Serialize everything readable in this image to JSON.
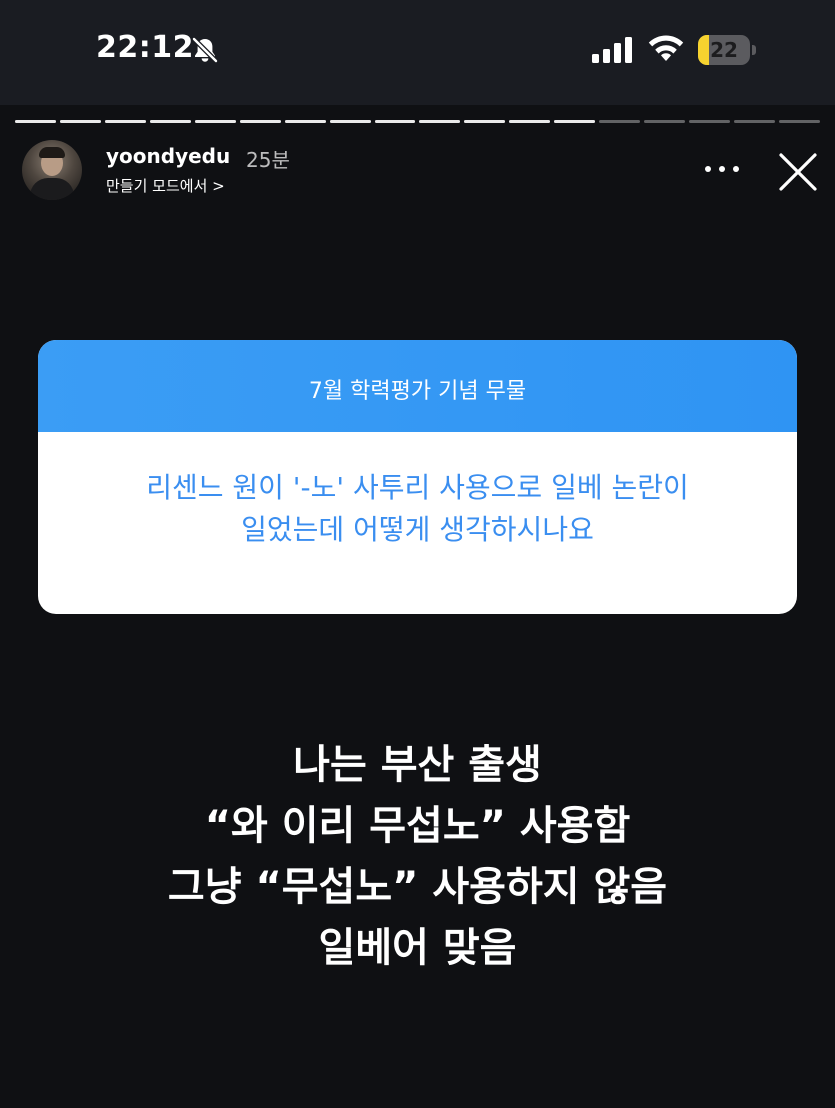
{
  "status_bar": {
    "time": "22:12",
    "battery_level": "22",
    "battery_fraction": 0.22,
    "icons": [
      "bell-slash-icon",
      "cellular-signal-icon",
      "wifi-icon",
      "battery-icon"
    ]
  },
  "story_progress": {
    "segment_count": 18,
    "viewed_count": 13
  },
  "story_header": {
    "username": "yoondyedu",
    "time_ago": "25분",
    "sub_label": "만들기 모드에서 >",
    "icons": [
      "more-options-icon",
      "close-icon"
    ]
  },
  "question_sticker": {
    "title": "7월 학력평가 기념 무물",
    "question": "리센느 원이 '-노' 사투리 사용으로 일베 논란이\n일었는데 어떻게 생각하시나요",
    "colors": {
      "header": "#3b9df5",
      "question_text": "#3a8ef0",
      "body": "#ffffff"
    }
  },
  "answer": {
    "text": "나는 부산 출생\n“와 이리 무섭노” 사용함\n그냥 “무섭노” 사용하지 않음\n일베어 맞음"
  },
  "colors": {
    "background": "#0f1013",
    "status_bar": "#1a1c22",
    "battery_fill": "#f7d32f"
  }
}
